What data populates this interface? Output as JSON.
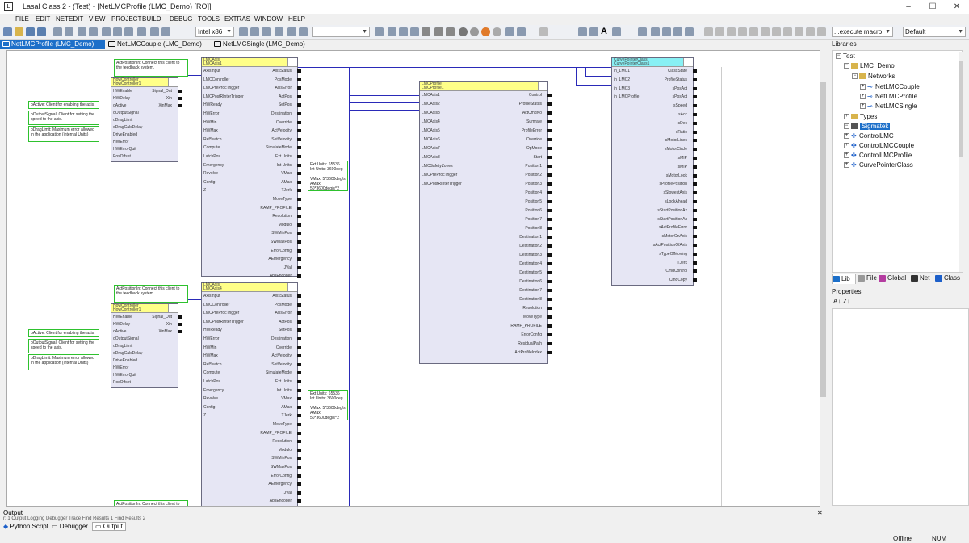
{
  "app": {
    "title": "Lasal Class 2 - (Test) - [NetLMCProfile (LMC_Demo) [RO]]"
  },
  "menu": [
    "FILE",
    "EDIT",
    "NETEDIT",
    "VIEW",
    "PROJECT",
    "BUILD",
    "DEBUG",
    "TOOLS",
    "EXTRAS",
    "WINDOW",
    "HELP"
  ],
  "toolbar": {
    "platform": "Intel x86",
    "macro": "...execute macro",
    "profile": "Default"
  },
  "doc_tabs": [
    "NetLMCProfile (LMC_Demo) [RO]",
    "NetLMCCouple (LMC_Demo) [RO]",
    "NetLMCSingle (LMC_Demo) [RO]"
  ],
  "libraries": {
    "title": "Libraries",
    "tree": {
      "root": "Test",
      "project": "LMC_Demo",
      "networks": "Networks",
      "net_items": [
        "NetLMCCouple",
        "NetLMCProfile",
        "NetLMCSingle"
      ],
      "types": "Types",
      "sigmatek": "Sigmatek",
      "classes": [
        "ControlLMC",
        "ControlLMCCouple",
        "ControlLMCProfile",
        "CurvePointerClass"
      ]
    },
    "tabs": [
      "Lib",
      "File",
      "Global",
      "Net",
      "Class"
    ]
  },
  "properties": {
    "title": "Properties",
    "sort_icons": [
      "A↓",
      "Z↓"
    ]
  },
  "output": {
    "title": "Output",
    "strip": "r: 1  Output  Logging  Debugger Trace  Find Results 1  Find Results 2",
    "tabs": [
      "Python Script",
      "Debugger",
      "Output"
    ]
  },
  "status": {
    "mode": "Offline",
    "num": "NUM"
  },
  "diagram": {
    "notes": {
      "pos": "ActPositionIn: Connect this client to the feedback system.",
      "active": "oActive: Client for enabling the axis.",
      "signal": "oOutputSignal: Client for setting the speed to the axis.",
      "drag": "oDragLimit: Maximum error allowed in the application (internal Units)",
      "units": "Ext Units: 65536\nInt Units: 3600deg\n\nVMax: 5*3600deg/s\nAMax: 50*3600deg/s^2"
    },
    "small_block": {
      "header": "HowController\nHowController1",
      "pins_in": [
        "HWEnable",
        "HWDelay",
        "oActive",
        "oOutputSignal",
        "oDragLimit",
        "oDragCalcDelay",
        "DriveEnabled",
        "HWError",
        "HWErrorQuit",
        "PosOffset"
      ],
      "pins_out": [
        "Signal_Out",
        "Xin",
        "XinMax"
      ]
    },
    "axis1_header": "LMCAxis\nLMCAxis1",
    "axis2_header": "LMCAxis\nLMCAxis4",
    "axis_pins_in": [
      "AxisInput",
      "LMCController",
      "LMCPreProcTrigger",
      "LMCPostRInterTrigger",
      "HWReady",
      "HWError",
      "HWMin",
      "HWMax",
      "RefSwitch",
      "Compute",
      "LatchPos",
      "Emergency",
      "Revolve",
      "Config",
      "Z"
    ],
    "axis_pins_out": [
      "AxisStatus",
      "PosMode",
      "AxisError",
      "ActPos",
      "SetPos",
      "Destination",
      "Override",
      "ActVelocity",
      "SetVelocity",
      "SimulateMode",
      "Ext Units",
      "Int Units",
      "VMax",
      "AMax",
      "TJerk",
      "MoveType",
      "RAMP_PROFILE",
      "Resolution",
      "Modulo",
      "SWMinPos",
      "SWMaxPos",
      "ErrorConfig",
      "AEmergency",
      "JVal",
      "AbsEncoder"
    ],
    "profile_block": {
      "header": "LMCProfile\nLMCProfile1",
      "pins_in": [
        "LMCAxis1",
        "LMCAxis2",
        "LMCAxis3",
        "LMCAxis4",
        "LMCAxis5",
        "LMCAxis6",
        "LMCAxis7",
        "LMCAxis8",
        "LMCSafetyZones",
        "LMCPreProcTrigger",
        "LMCPostRInterTrigger"
      ],
      "pins_out": [
        "Control",
        "ProfileStatus",
        "ActCmdNo",
        "Sumrate",
        "ProfileError",
        "Override",
        "OpMode",
        "Start",
        "Position1",
        "Position2",
        "Position3",
        "Position4",
        "Position5",
        "Position6",
        "Position7",
        "Position8",
        "Destination1",
        "Destination2",
        "Destination3",
        "Destination4",
        "Destination5",
        "Destination6",
        "Destination7",
        "Destination8",
        "Resolution",
        "MoveType",
        "RAMP_PROFILE",
        "ErrorConfig",
        "ResidualPath",
        "ActProfileIndex"
      ]
    },
    "cpc_block": {
      "header": "CurvePointerClass\nCurvePointerClass1",
      "pins_in": [
        "in_LMC1",
        "in_LMC2",
        "in_LMC3",
        "in_LMCProfile"
      ],
      "pins_out": [
        "ClassState",
        "ProfileStatus",
        "sPosAct",
        "sPosAct",
        "sSpeed",
        "sAcc",
        "sDec",
        "sRatio",
        "sMotorLines",
        "sMotorCircle",
        "sMIP",
        "sMIP",
        "sMotorLook",
        "sProfilePosition",
        "sSlowestAxis",
        "sLookAhead",
        "sStartPositionAx",
        "sStartPositionAx",
        "sActProfileError",
        "sMotorOnAxis",
        "sActPositionOfAxis",
        "sTypeOfMoving",
        "TJerk",
        "CmdControl",
        "CmdCopy"
      ]
    }
  }
}
